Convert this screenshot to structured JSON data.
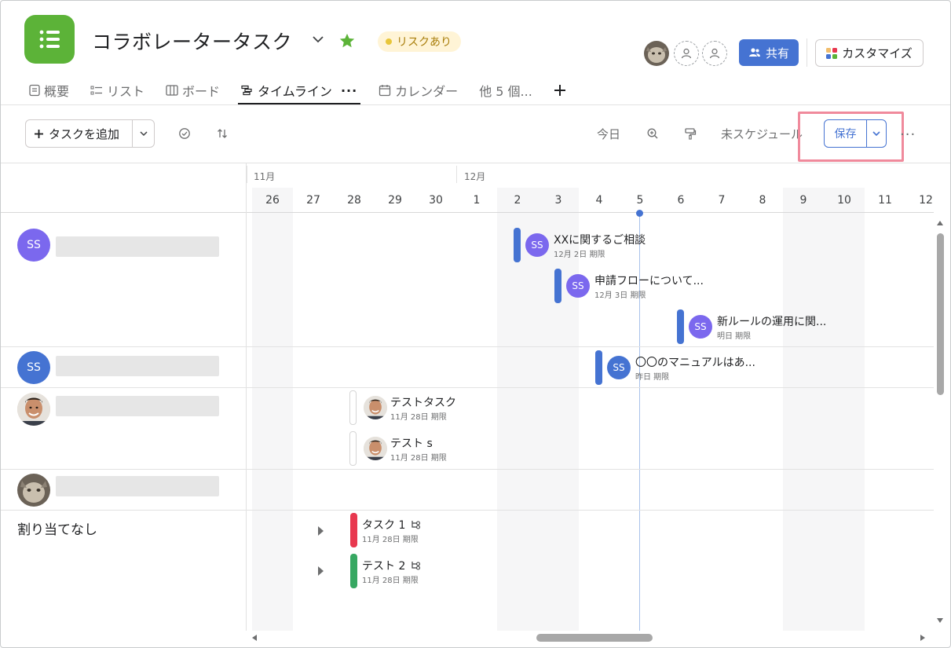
{
  "header": {
    "title": "コラボレータータスク",
    "risk_badge": "リスクあり",
    "share_label": "共有",
    "customize_label": "カスタマイズ"
  },
  "tabs": [
    {
      "label": "概要",
      "icon": "overview-icon"
    },
    {
      "label": "リスト",
      "icon": "list-icon"
    },
    {
      "label": "ボード",
      "icon": "board-icon"
    },
    {
      "label": "タイムライン",
      "icon": "timeline-icon",
      "active": true
    },
    {
      "label": "カレンダー",
      "icon": "calendar-icon"
    },
    {
      "label": "他 5 個...",
      "icon": ""
    }
  ],
  "toolbar": {
    "add_task_label": "タスクを追加",
    "today_label": "今日",
    "unscheduled_label": "未スケジュール",
    "save_label": "保存"
  },
  "timeline": {
    "months": [
      "11月",
      "12月"
    ],
    "days": [
      "26",
      "27",
      "28",
      "29",
      "30",
      "1",
      "2",
      "3",
      "4",
      "5",
      "6",
      "7",
      "8",
      "9",
      "10",
      "11",
      "12"
    ],
    "today": "5"
  },
  "groups": {
    "g1_initials": "SS",
    "g2_initials": "SS",
    "unassigned_label": "割り当てなし"
  },
  "tasks": [
    {
      "name": "XXに関するご相談",
      "due": "12月 2日 期限",
      "initials": "SS",
      "color": "#4573d2"
    },
    {
      "name": "申請フローについて...",
      "due": "12月 3日 期限",
      "initials": "SS",
      "color": "#4573d2"
    },
    {
      "name": "新ルールの運用に関...",
      "due": "明日 期限",
      "initials": "SS",
      "color": "#4573d2"
    },
    {
      "name": "〇〇のマニュアルはあ...",
      "due": "昨日 期限",
      "initials": "SS",
      "color": "#4573d2"
    },
    {
      "name": "テストタスク",
      "due": "11月 28日 期限",
      "initials": "",
      "color": "#ffffff"
    },
    {
      "name": "テスト s",
      "due": "11月 28日 期限",
      "initials": "",
      "color": "#ffffff"
    },
    {
      "name": "タスク 1",
      "due": "11月 28日 期限",
      "initials": "",
      "color": "#e8384f"
    },
    {
      "name": "テスト 2",
      "due": "11月 28日 期限",
      "initials": "",
      "color": "#37a862"
    }
  ],
  "colors": {
    "brand_green": "#5cb338",
    "accent_blue": "#4573d2",
    "avatar_purple": "#7b68ee",
    "avatar_blue": "#4573d2",
    "highlight_pink": "#f08a9c"
  }
}
